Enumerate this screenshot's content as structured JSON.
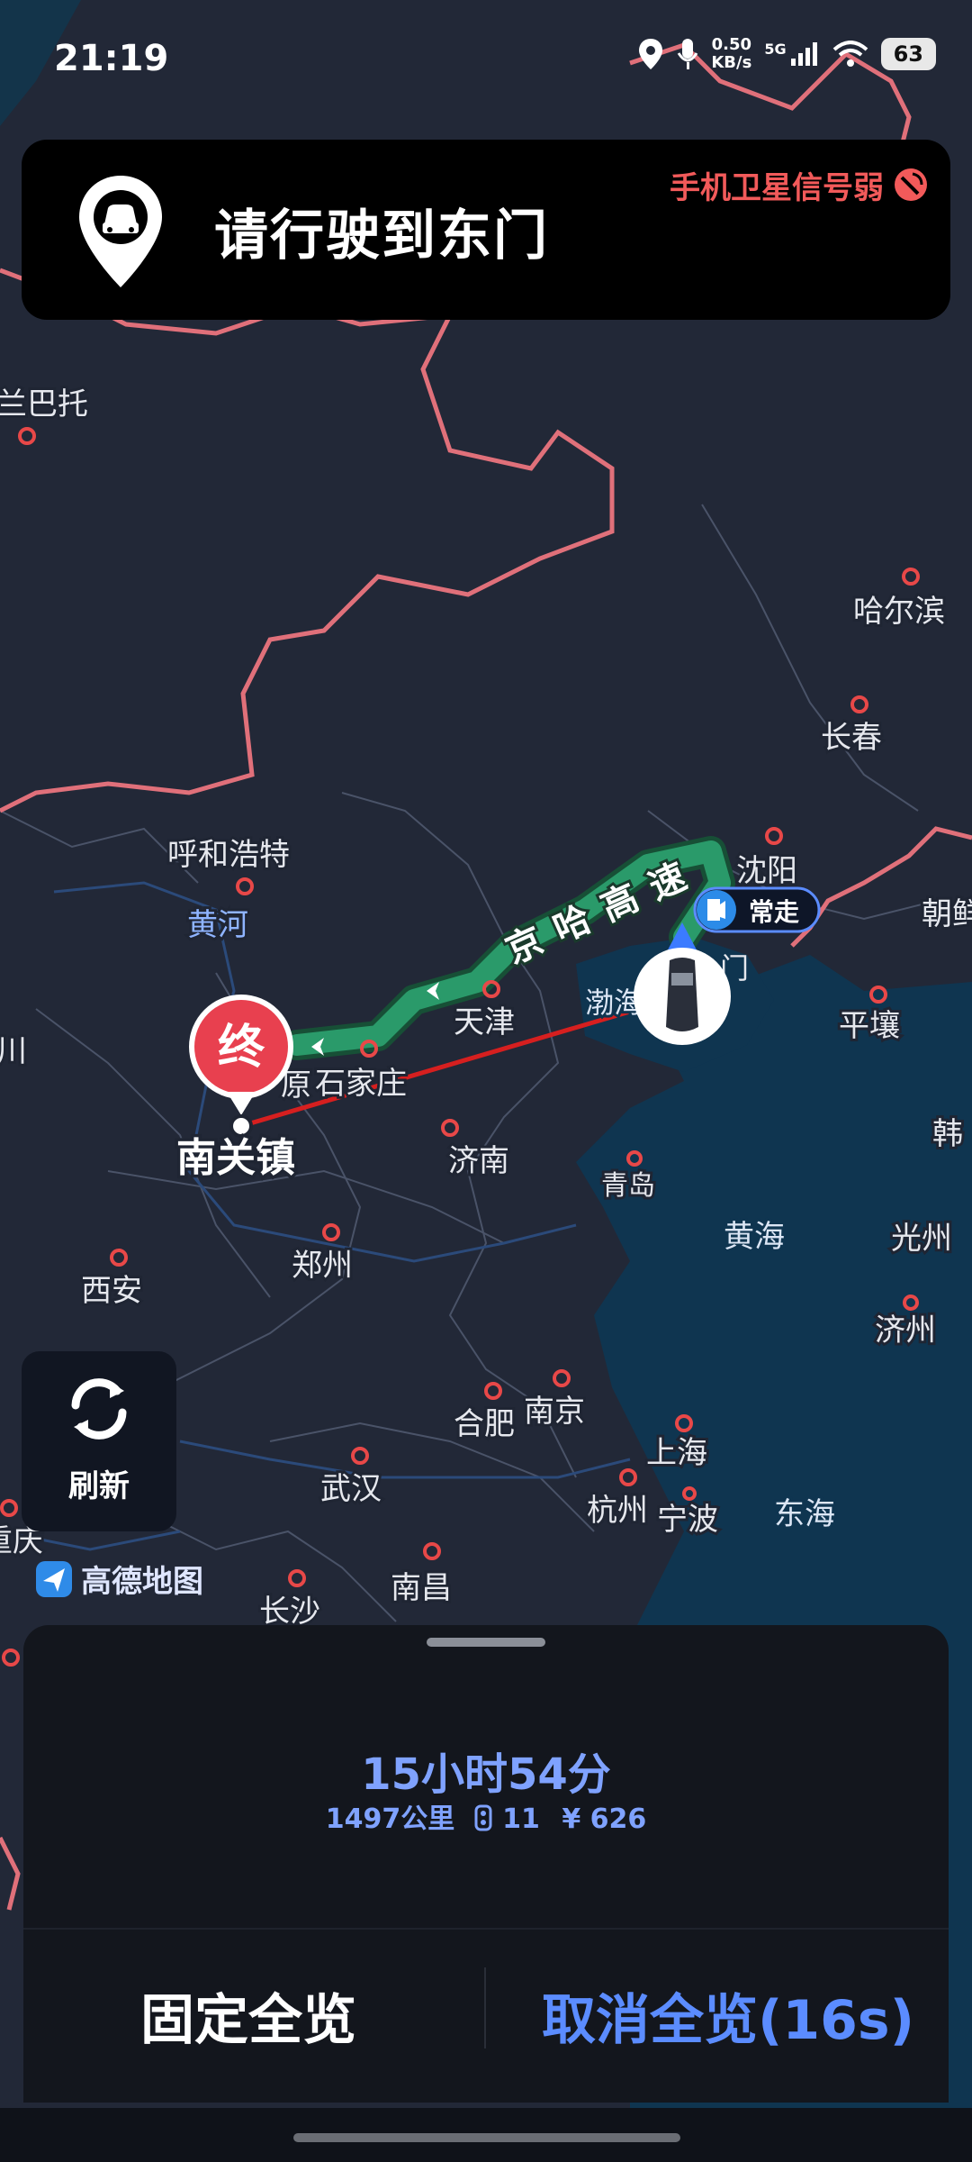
{
  "status_bar": {
    "time": "21:19",
    "net_speed_top": "0.50",
    "net_speed_bottom": "KB/s",
    "network": "5G",
    "battery": "63"
  },
  "nav_card": {
    "instruction": "请行驶到东门",
    "gps_warning": "手机卫星信号弱",
    "icon": "car-location-pin-icon"
  },
  "map": {
    "route_label": "京哈高速",
    "end_marker": "终",
    "frequent_label": "常走",
    "destination": "南关镇",
    "east_gate_fragment": "门",
    "bohai_fragment": "渤海",
    "places": {
      "lanbatuo": "兰巴托",
      "haerbin": "哈尔滨",
      "changchun": "长春",
      "shenyang": "沈阳",
      "huhehaote": "呼和浩特",
      "huanghe": "黄河",
      "tianjin": "天津",
      "shijiazhuang": "石家庄",
      "taiyuan_fragment": "原",
      "jinan": "济南",
      "qingdao": "青岛",
      "huanghai": "黄海",
      "pingrang": "平壤",
      "chaoxian_fragment": "朝鲜",
      "han_fragment": "韩",
      "guangzhou_kr": "光州",
      "jizhou": "济州",
      "zhengzhou": "郑州",
      "xian": "西安",
      "hefei": "合肥",
      "nanjing": "南京",
      "shanghai": "上海",
      "hangzhou": "杭州",
      "ningbo": "宁波",
      "donghai": "东海",
      "wuhan": "武汉",
      "nanchang": "南昌",
      "changsha": "长沙",
      "chongqing_fragment": "重庆",
      "chuan_fragment": "川"
    },
    "brand": "高德地图",
    "route_color": "#2a9a6a",
    "border_color": "#e0707a"
  },
  "refresh_button": {
    "label": "刷新"
  },
  "route_summary": {
    "duration": "15小时54分",
    "distance": "1497公里",
    "traffic_lights": "11",
    "cost": "¥ 626"
  },
  "actions": {
    "fixed_overview": "固定全览",
    "cancel_overview": "取消全览(16s)"
  }
}
